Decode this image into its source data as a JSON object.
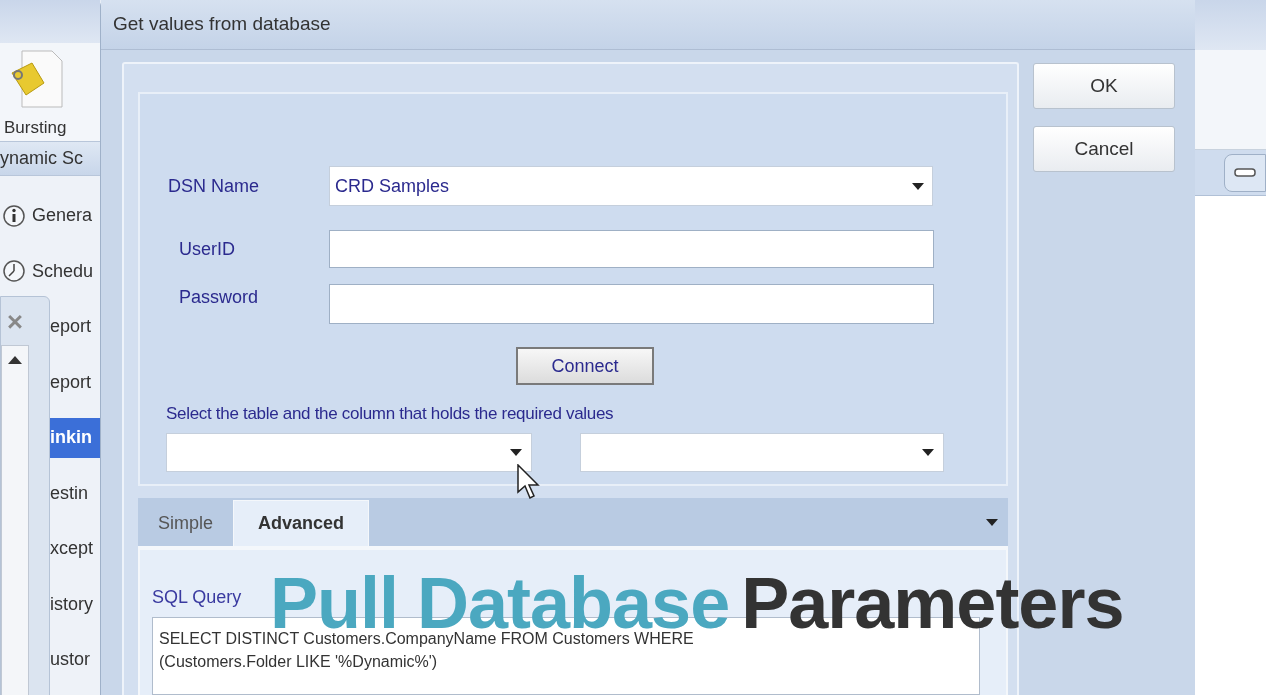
{
  "background_app": {
    "ribbon_button": "Bursting",
    "section_title": "ynamic Sc",
    "nav_items": [
      {
        "label": "Genera",
        "kind": "info",
        "selected": false
      },
      {
        "label": "Schedu",
        "kind": "clock",
        "selected": false
      },
      {
        "label": "eport",
        "kind": "plain",
        "selected": false
      },
      {
        "label": "eport",
        "kind": "plain",
        "selected": false
      },
      {
        "label": "inkin",
        "kind": "plain",
        "selected": true
      },
      {
        "label": "estin",
        "kind": "plain",
        "selected": false
      },
      {
        "label": "xcept",
        "kind": "plain",
        "selected": false
      },
      {
        "label": "istory",
        "kind": "plain",
        "selected": false
      },
      {
        "label": "ustor",
        "kind": "plain",
        "selected": false
      }
    ]
  },
  "dialog": {
    "title": "Get values from database",
    "dsn": {
      "label": "DSN Name",
      "value": "CRD Samples"
    },
    "user_id": {
      "label": "UserID"
    },
    "password": {
      "label": "Password"
    },
    "connect_button": "Connect",
    "select_label": "Select the table and the column that holds the required values",
    "tabs": [
      {
        "label": "Simple",
        "selected": false
      },
      {
        "label": "Advanced",
        "selected": true
      }
    ],
    "sql_label": "SQL Query",
    "sql_text": "SELECT DISTINCT Customers.CompanyName FROM Customers WHERE (Customers.Folder LIKE '%Dynamic%')",
    "buttons": [
      "OK",
      "Cancel"
    ]
  },
  "caption": {
    "highlight": "Pull Database",
    "rest": "Parameters"
  }
}
